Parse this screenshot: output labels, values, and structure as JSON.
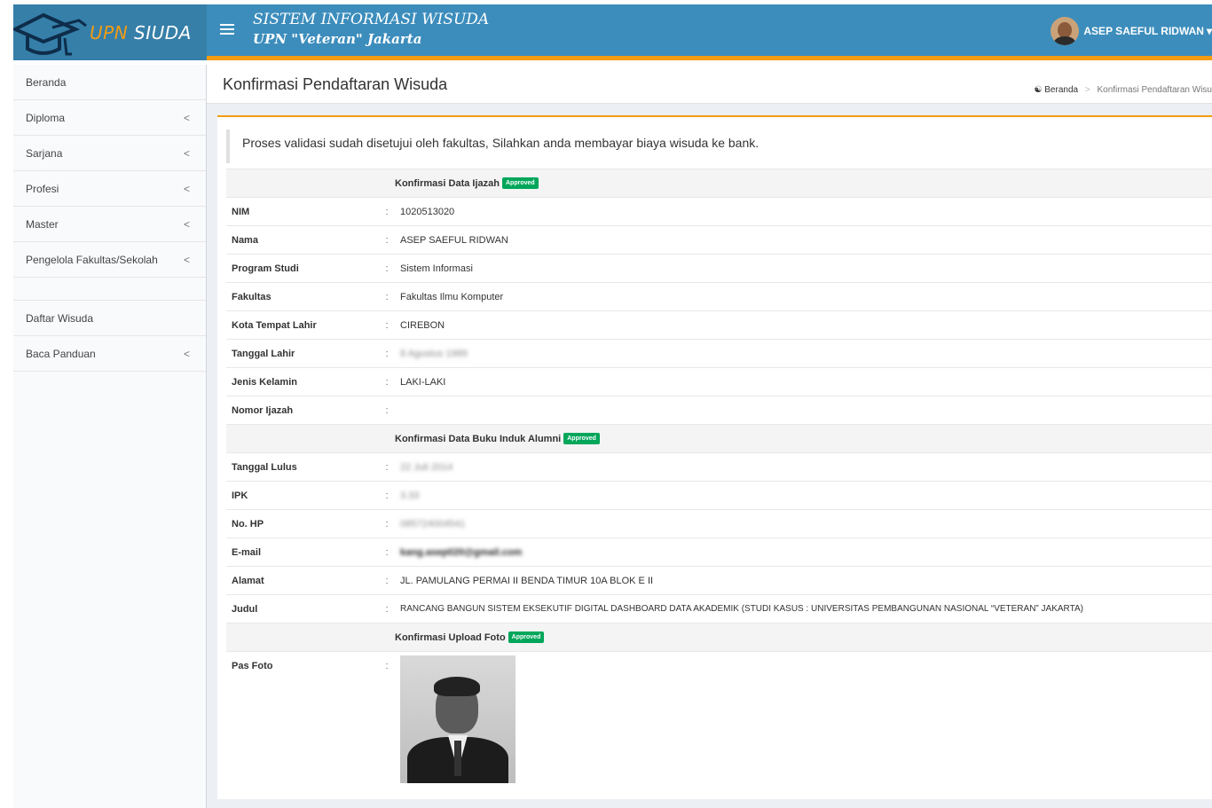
{
  "header": {
    "logo": {
      "prefix": "UPN",
      "suffix": " SIUDA"
    },
    "brand_line1": "SISTEM INFORMASI WISUDA",
    "brand_line2": "UPN \"Veteran\" Jakarta",
    "user_name": "ASEP SAEFUL RIDWAN"
  },
  "sidebar": {
    "items": [
      {
        "label": "Beranda",
        "has_submenu": false
      },
      {
        "label": "Diploma",
        "has_submenu": true
      },
      {
        "label": "Sarjana",
        "has_submenu": true
      },
      {
        "label": "Profesi",
        "has_submenu": true
      },
      {
        "label": "Master",
        "has_submenu": true
      },
      {
        "label": "Pengelola Fakultas/Sekolah",
        "has_submenu": true
      }
    ],
    "items2": [
      {
        "label": "Daftar Wisuda",
        "has_submenu": false
      },
      {
        "label": "Baca Panduan",
        "has_submenu": true
      }
    ],
    "chevron": "<"
  },
  "page": {
    "title": "Konfirmasi Pendaftaran Wisuda",
    "breadcrumb": {
      "home": "Beranda",
      "sep": ">",
      "current": "Konfirmasi Pendaftaran Wisu"
    },
    "callout": "Proses validasi sudah disetujui oleh fakultas, Silahkan anda membayar biaya wisuda ke bank."
  },
  "sections": {
    "ijazah": {
      "title": "Konfirmasi Data Ijazah",
      "badge": "Approved"
    },
    "alumni": {
      "title": "Konfirmasi Data Buku Induk Alumni",
      "badge": "Approved"
    },
    "foto": {
      "title": "Konfirmasi Upload Foto",
      "badge": "Approved"
    }
  },
  "fields": {
    "nim": {
      "label": "NIM",
      "value": "1020513020"
    },
    "nama": {
      "label": "Nama",
      "value": "ASEP SAEFUL RIDWAN"
    },
    "prodi": {
      "label": "Program Studi",
      "value": "Sistem Informasi"
    },
    "fakultas": {
      "label": "Fakultas",
      "value": "Fakultas Ilmu Komputer"
    },
    "kota": {
      "label": "Kota Tempat Lahir",
      "value": "CIREBON"
    },
    "tgl_lahir": {
      "label": "Tanggal Lahir",
      "value": "8 Agustus 1989"
    },
    "jk": {
      "label": "Jenis Kelamin",
      "value": "LAKI-LAKI"
    },
    "no_ijazah": {
      "label": "Nomor Ijazah",
      "value": ""
    },
    "tgl_lulus": {
      "label": "Tanggal Lulus",
      "value": "22 Juli 2014"
    },
    "ipk": {
      "label": "IPK",
      "value": "3.33"
    },
    "hp": {
      "label": "No. HP",
      "value": "085724004541"
    },
    "email": {
      "label": "E-mail",
      "value": "kang.asep020@gmail.com"
    },
    "alamat": {
      "label": "Alamat",
      "value": "JL. PAMULANG PERMAI II BENDA TIMUR 10A BLOK E II"
    },
    "judul": {
      "label": "Judul",
      "value": "RANCANG BANGUN SISTEM EKSEKUTIF DIGITAL DASHBOARD DATA AKADEMIK (STUDI KASUS : UNIVERSITAS PEMBANGUNAN NASIONAL “VETERAN” JAKARTA)"
    },
    "pas_foto": {
      "label": "Pas Foto"
    }
  },
  "colon": ":",
  "colors": {
    "navbar": "#3c8dbc",
    "logo_bg": "#367fa9",
    "accent": "#f39c12",
    "approved": "#00a65a"
  }
}
